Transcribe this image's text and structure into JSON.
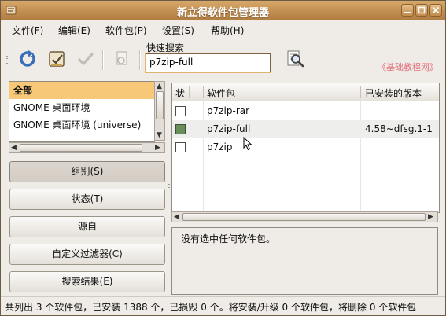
{
  "window": {
    "title": "新立得软件包管理器"
  },
  "menu": [
    "文件(F)",
    "编辑(E)",
    "软件包(P)",
    "设置(S)",
    "帮助(H)"
  ],
  "toolbar": {
    "buttons": [
      "reload-icon",
      "mark-all-upgrades-icon",
      "apply-icon",
      "properties-icon",
      "search-icon"
    ],
    "quick_search_label": "快速搜索",
    "quick_search_value": "p7zip-full"
  },
  "watermark": "《基础教程网》",
  "categories": [
    "全部",
    "GNOME 桌面环境",
    "GNOME 桌面环境 (universe)"
  ],
  "filter_buttons": [
    "组别(S)",
    "状态(T)",
    "源自",
    "自定义过滤器(C)",
    "搜索结果(E)"
  ],
  "table": {
    "columns": [
      "状",
      "软件包",
      "已安装的版本"
    ],
    "rows": [
      {
        "name": "p7zip-rar",
        "installed": "",
        "checked": false
      },
      {
        "name": "p7zip-full",
        "installed": "4.58~dfsg.1-1",
        "checked": true
      },
      {
        "name": "p7zip",
        "installed": "",
        "checked": false
      }
    ]
  },
  "info_text": "没有选中任何软件包。",
  "status_text": "共列出 3 个软件包，已安装 1388 个，已损毁 0 个。将安装/升级 0 个软件包，将删除 0 个软件包",
  "colors": {
    "titlebar": "#c38f51",
    "selection": "#f7c878",
    "watermark": "#e26f7a"
  }
}
